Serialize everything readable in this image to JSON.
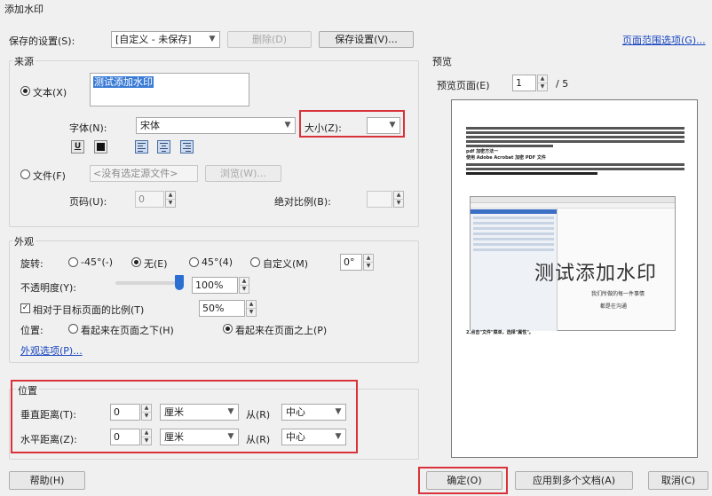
{
  "window": {
    "title": "添加水印"
  },
  "settings": {
    "saved_label": "保存的设置(S):",
    "saved_value": "[自定义 - 未保存]",
    "delete_label": "删除(D)",
    "save_label": "保存设置(V)...",
    "page_range_link": "页面范围选项(G)..."
  },
  "source": {
    "group_title": "来源",
    "text_radio": "文本(X)",
    "text_value": "测试添加水印",
    "font_label": "字体(N):",
    "font_value": "宋体",
    "size_label": "大小(Z):",
    "size_value": "",
    "underline_glyph": "U",
    "file_radio": "文件(F)",
    "file_value": "<没有选定源文件>",
    "browse_label": "浏览(W)...",
    "page_label": "页码(U):",
    "page_value": "0",
    "scale_label": "绝对比例(B):",
    "scale_value": ""
  },
  "appearance": {
    "group_title": "外观",
    "rotation_label": "旋转:",
    "rot_minus45": "-45°(-)",
    "rot_none": "无(E)",
    "rot_45": "45°(4)",
    "rot_custom": "自定义(M)",
    "rot_custom_value": "0°",
    "opacity_label": "不透明度(Y):",
    "opacity_value": "100%",
    "opacity_fraction": 1.0,
    "relative_scale_label": "相对于目标页面的比例(T)",
    "relative_scale_value": "50%",
    "position_label": "位置:",
    "behind_page": "看起来在页面之下(H)",
    "above_page": "看起来在页面之上(P)",
    "options_link": "外观选项(P)..."
  },
  "position": {
    "group_title": "位置",
    "vertical_label": "垂直距离(T):",
    "vertical_value": "0",
    "vertical_unit": "厘米",
    "vertical_from": "从(R)",
    "vertical_anchor": "中心",
    "horizontal_label": "水平距离(Z):",
    "horizontal_value": "0",
    "horizontal_unit": "厘米",
    "horizontal_from": "从(R)",
    "horizontal_anchor": "中心"
  },
  "preview": {
    "group_title": "预览",
    "page_label": "预览页面(E)",
    "page_value": "1",
    "page_total": "/ 5",
    "watermark_text": "测试添加水印",
    "doc_heading_1": "pdf 加密方法一",
    "doc_heading_2": "使用 Adobe Acrobat 加密 PDF 文件",
    "doc_footer": "2.点击\"文件\"菜单，选择\"属性\"。",
    "inner_caption_1": "我们所做的每一件事情",
    "inner_caption_2": "都是在沟通"
  },
  "footer": {
    "help_label": "帮助(H)",
    "ok_label": "确定(O)",
    "apply_multi_label": "应用到多个文档(A)",
    "cancel_label": "取消(C)"
  },
  "colors": {
    "highlight": "#d9323a",
    "link": "#1a47c2",
    "selection": "#3a7bd5"
  }
}
